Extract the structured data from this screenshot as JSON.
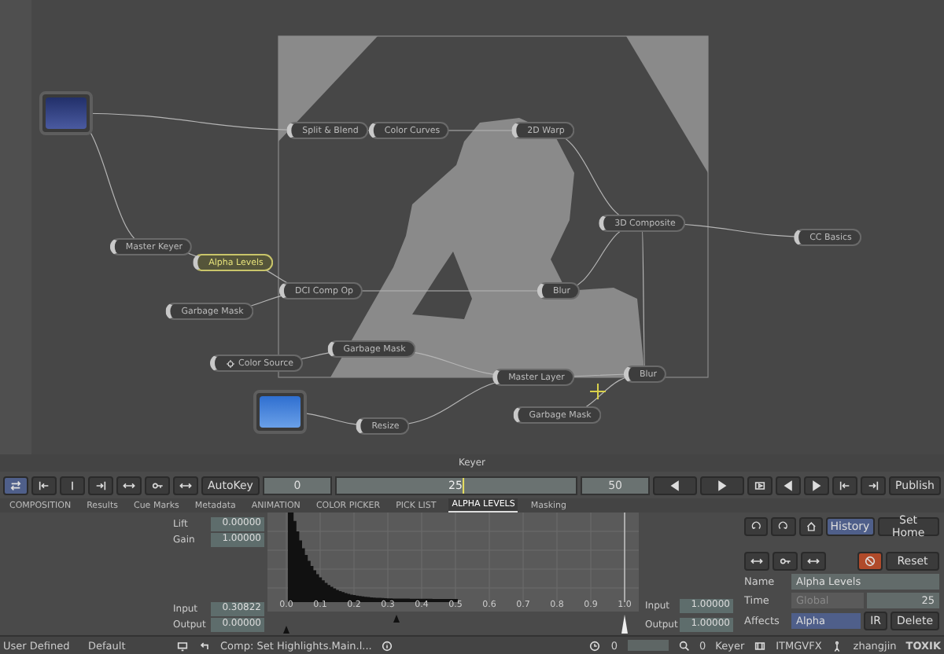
{
  "node_graph": {
    "nodes": [
      {
        "kind": "clip"
      },
      {
        "kind": "op",
        "label": "Split & Blend",
        "selected": false
      },
      {
        "kind": "op",
        "label": "Color Curves",
        "selected": false
      },
      {
        "kind": "op",
        "label": "2D Warp",
        "selected": false
      },
      {
        "kind": "op",
        "label": "3D Composite",
        "selected": false
      },
      {
        "kind": "op",
        "label": "CC Basics",
        "selected": false
      },
      {
        "kind": "op",
        "label": "Master Keyer",
        "selected": false
      },
      {
        "kind": "op",
        "label": "Alpha Levels",
        "selected": true
      },
      {
        "kind": "op",
        "label": "DCI Comp Op",
        "selected": false
      },
      {
        "kind": "op",
        "label": "Blur",
        "selected": false
      },
      {
        "kind": "op",
        "label": "Garbage Mask",
        "selected": false
      },
      {
        "kind": "op",
        "label": "Garbage Mask",
        "selected": false
      },
      {
        "kind": "source",
        "label": "Color Source",
        "selected": false
      },
      {
        "kind": "op",
        "label": "Master Layer",
        "selected": false
      },
      {
        "kind": "op",
        "label": "Blur",
        "selected": false
      },
      {
        "kind": "clip"
      },
      {
        "kind": "op",
        "label": "Resize",
        "selected": false
      },
      {
        "kind": "op",
        "label": "Garbage Mask",
        "selected": false
      }
    ]
  },
  "panel_title": "Keyer",
  "toolbar": {
    "autokey": "AutoKey",
    "start": "0",
    "current": "25",
    "end": "50",
    "level": 0.5,
    "publish": "Publish"
  },
  "tabs": [
    {
      "label": "COMPOSITION",
      "selected": false
    },
    {
      "label": "Results",
      "selected": false
    },
    {
      "label": "Cue Marks",
      "selected": false
    },
    {
      "label": "Metadata",
      "selected": false
    },
    {
      "label": "ANIMATION",
      "selected": false
    },
    {
      "label": "COLOR PICKER",
      "selected": false
    },
    {
      "label": "PICK LIST",
      "selected": false
    },
    {
      "label": "ALPHA LEVELS",
      "selected": true
    },
    {
      "label": "Masking",
      "selected": false
    }
  ],
  "levels": {
    "left": [
      {
        "label": "Lift",
        "value": "0.00000"
      },
      {
        "label": "Gain",
        "value": "1.00000"
      },
      {
        "label": "Input",
        "value": "0.30822"
      },
      {
        "label": "Output",
        "value": "0.00000"
      }
    ],
    "right": [
      {
        "label": "Input",
        "value": "1.00000"
      },
      {
        "label": "Output",
        "value": "1.00000"
      }
    ],
    "histogram_ticks": [
      "0.0",
      "0.1",
      "0.2",
      "0.3",
      "0.4",
      "0.5",
      "0.6",
      "0.7",
      "0.8",
      "0.9",
      "1.0"
    ]
  },
  "properties": {
    "history": {
      "label": "History",
      "selected": true
    },
    "set_home": "Set Home",
    "reset": "Reset",
    "fields": [
      {
        "label": "Name",
        "value": "Alpha Levels"
      },
      {
        "label": "Time",
        "value": "Global",
        "disabled": true,
        "frame": "25"
      },
      {
        "label": "Affects",
        "value": "Alpha",
        "ir": "IR",
        "action": "Delete"
      }
    ]
  },
  "status_bar": {
    "left": [
      "User Defined",
      "Default"
    ],
    "comp": "Comp: Set Highlights.Main.l...",
    "timer": "0",
    "search": "0",
    "keyer": "Keyer",
    "project": "ITMGVFX",
    "user": "zhangjin",
    "brand": "TOXIK"
  }
}
